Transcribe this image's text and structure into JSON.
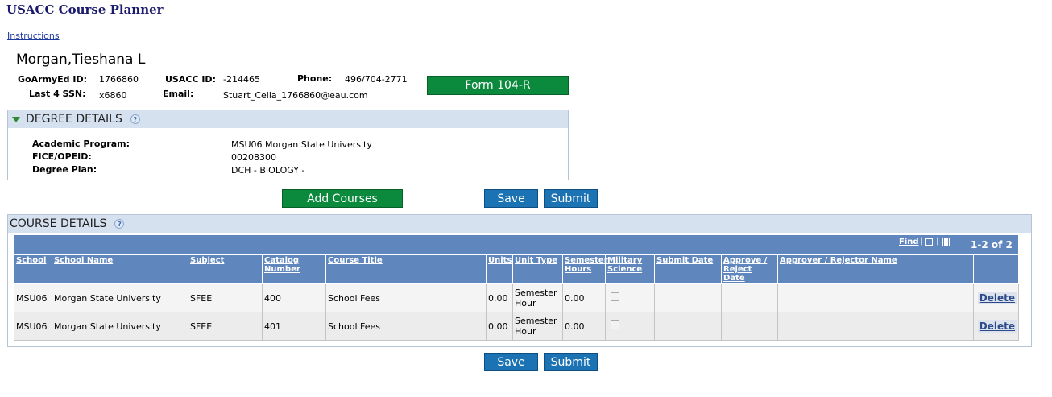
{
  "app": {
    "title": "USACC Course Planner",
    "instructions_link": "Instructions"
  },
  "student": {
    "name": "Morgan,Tieshana L",
    "goarmyed_label": "GoArmyEd ID:",
    "goarmyed_id": "1766860",
    "usacc_label": "USACC ID:",
    "usacc_id": "-214465",
    "phone_label": "Phone:",
    "phone": "496/704-2771",
    "ssn_label": "Last 4 SSN:",
    "ssn": "x6860",
    "email_label": "Email:",
    "email": "Stuart_Celia_1766860@eau.com"
  },
  "buttons": {
    "form": "Form 104-R",
    "add_courses": "Add Courses",
    "save": "Save",
    "submit": "Submit",
    "delete": "Delete"
  },
  "degree": {
    "header": "DEGREE DETAILS",
    "program_label": "Academic Program:",
    "program_value": "MSU06  Morgan State University",
    "fice_label": "FICE/OPEID:",
    "fice_value": "00208300",
    "plan_label": "Degree Plan:",
    "plan_value": "DCH - BIOLOGY -"
  },
  "courses": {
    "header": "COURSE DETAILS",
    "find": "Find",
    "pagination": "1-2 of 2",
    "columns": [
      "School",
      "School Name",
      "Subject",
      "Catalog Number",
      "Course Title",
      "Units",
      "Unit Type",
      "Semester Hours",
      "Military Science",
      "Submit Date",
      "Approve / Reject Date",
      "Approver / Rejector Name",
      ""
    ],
    "rows": [
      {
        "school": "MSU06",
        "school_name": "Morgan State University",
        "subject": "SFEE",
        "catalog": "400",
        "title": "School Fees",
        "units": "0.00",
        "unit_type": "Semester Hour",
        "semester_hours": "0.00"
      },
      {
        "school": "MSU06",
        "school_name": "Morgan State University",
        "subject": "SFEE",
        "catalog": "401",
        "title": "School Fees",
        "units": "0.00",
        "unit_type": "Semester Hour",
        "semester_hours": "0.00"
      }
    ]
  },
  "colors": {
    "green": "#0b8a3e",
    "blue": "#1c73b3",
    "grid_header": "#5f86bd",
    "panel_header": "#d6e1f0"
  },
  "icons": {
    "help": "help-icon",
    "collapse": "triangle-down-icon",
    "view_all": "view-all-icon",
    "download": "grid-download-icon"
  }
}
